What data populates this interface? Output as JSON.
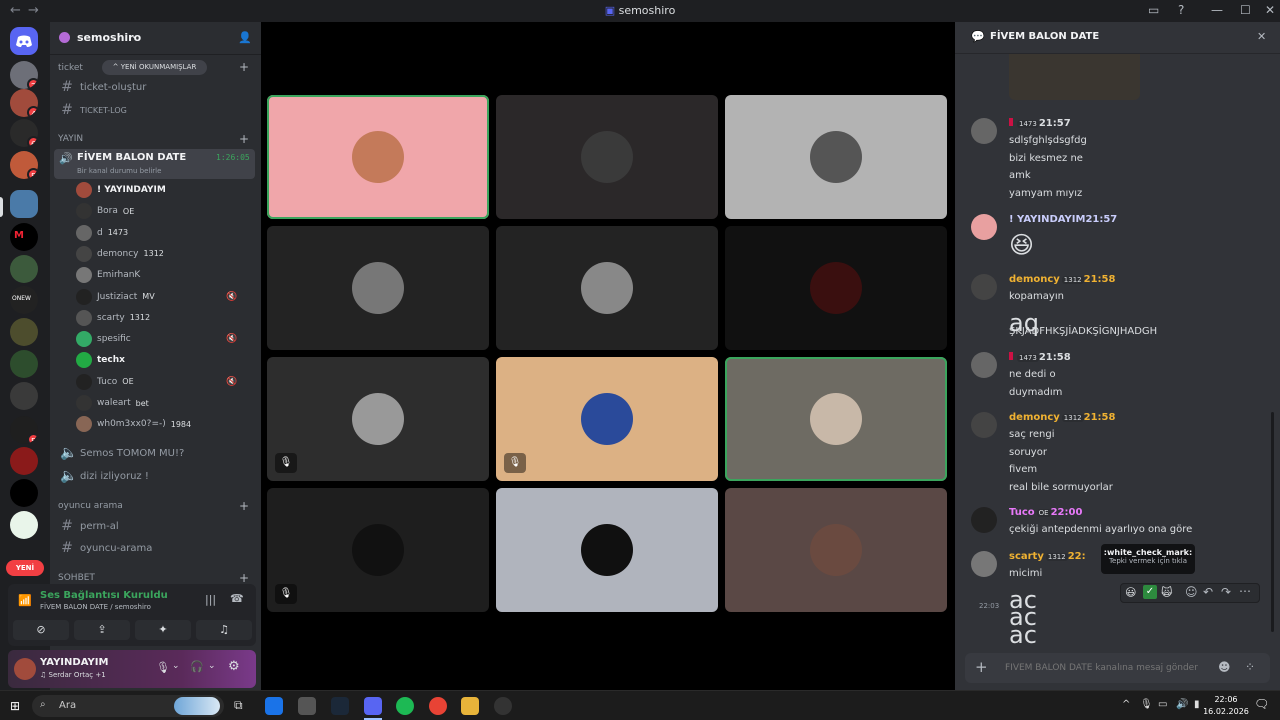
{
  "window": {
    "title": "semoshiro"
  },
  "server": {
    "name": "semoshiro"
  },
  "rail": {
    "badges": [
      "2",
      "4",
      "6",
      "5",
      "5"
    ],
    "new_label": "YENİ"
  },
  "sidebar": {
    "cat_ticket": "ticket",
    "unread_pill": "YENİ OKUNMAMIŞLAR",
    "channels_top": [
      "ticket-oluştur",
      "TICKET-LOG"
    ],
    "cat_yayin": "YAYIN",
    "active_voice": {
      "name": "FİVEM BALON DATE",
      "timer": "1:26:05",
      "status": "Bir kanal durumu belirle"
    },
    "voice_users": [
      {
        "name": "! YAYINDAYIM",
        "tag": ""
      },
      {
        "name": "Bora",
        "tag": "OE"
      },
      {
        "name": "d",
        "tag": "1473"
      },
      {
        "name": "demoncy",
        "tag": "1312"
      },
      {
        "name": "EmirhanK",
        "tag": ""
      },
      {
        "name": "Justiziact",
        "tag": "MV"
      },
      {
        "name": "scarty",
        "tag": "1312"
      },
      {
        "name": "spesific",
        "tag": ""
      },
      {
        "name": "techx",
        "tag": ""
      },
      {
        "name": "Tuco",
        "tag": "OE"
      },
      {
        "name": "waleart",
        "tag": "bet"
      },
      {
        "name": "wh0m3xx0?=-)",
        "tag": "1984"
      }
    ],
    "voice_channels": [
      "Semos TOMOM MU!?",
      "dizi izliyoruz !"
    ],
    "cat_oyuncu": "oyuncu arama",
    "channels_oyuncu": [
      "perm-al",
      "oyuncu-arama"
    ],
    "cat_sohbet": "SOHBET"
  },
  "voice_panel": {
    "status": "Ses Bağlantısı Kuruldu",
    "location": "FİVEM BALON DATE / semoshiro"
  },
  "user_panel": {
    "name": "YAYINDAYIM",
    "activity": "Serdar Ortaç +1"
  },
  "chat": {
    "title": "FİVEM BALON DATE",
    "messages": [
      {
        "name": "",
        "tag": "1473",
        "time": "21:57",
        "color": "#dbdee1",
        "lines": [
          "sdlşfghlşdsgfdg",
          "bizi kesmez ne",
          "amk",
          "yamyam mıyız"
        ]
      },
      {
        "name": "! YAYINDAYIM",
        "tag": "",
        "time": "21:57",
        "color": "#c9cdfb",
        "lines": [
          "😆"
        ]
      },
      {
        "name": "demoncy",
        "tag": "1312",
        "time": "21:58",
        "color": "#f0b232",
        "lines": [
          "kopamayın",
          "aq",
          "ŞKJADFHKŞJİADKŞİGNJHADGH"
        ]
      },
      {
        "name": "",
        "tag": "1473",
        "time": "21:58",
        "color": "#dbdee1",
        "lines": [
          "ne dedi o",
          "duymadım"
        ]
      },
      {
        "name": "demoncy",
        "tag": "1312",
        "time": "21:58",
        "color": "#f0b232",
        "lines": [
          "saç rengi",
          "soruyor",
          "fivem",
          "real bile sormuyorlar"
        ]
      },
      {
        "name": "Tuco",
        "tag": "OE",
        "time": "22:00",
        "color": "#e879f9",
        "lines": [
          "çekiği antepdenmi ayarlıyo ona göre"
        ]
      },
      {
        "name": "scarty",
        "tag": "1312",
        "time": "22:",
        "color": "#f0b232",
        "lines": [
          "micimi",
          "ac",
          "ac",
          "ac"
        ]
      }
    ],
    "hover_time": "22:03",
    "tooltip_title": ":white_check_mark:",
    "tooltip_sub": "Tepki vermek için tıkla",
    "composer_placeholder": "FİVEM BALON DATE kanalına mesaj gönder"
  },
  "taskbar": {
    "search": "Ara",
    "time": "22:06",
    "date": "16.02.2026"
  },
  "colors": {
    "accent": "#5865f2",
    "speaking": "#3ba55d",
    "badge": "#f23f43"
  }
}
